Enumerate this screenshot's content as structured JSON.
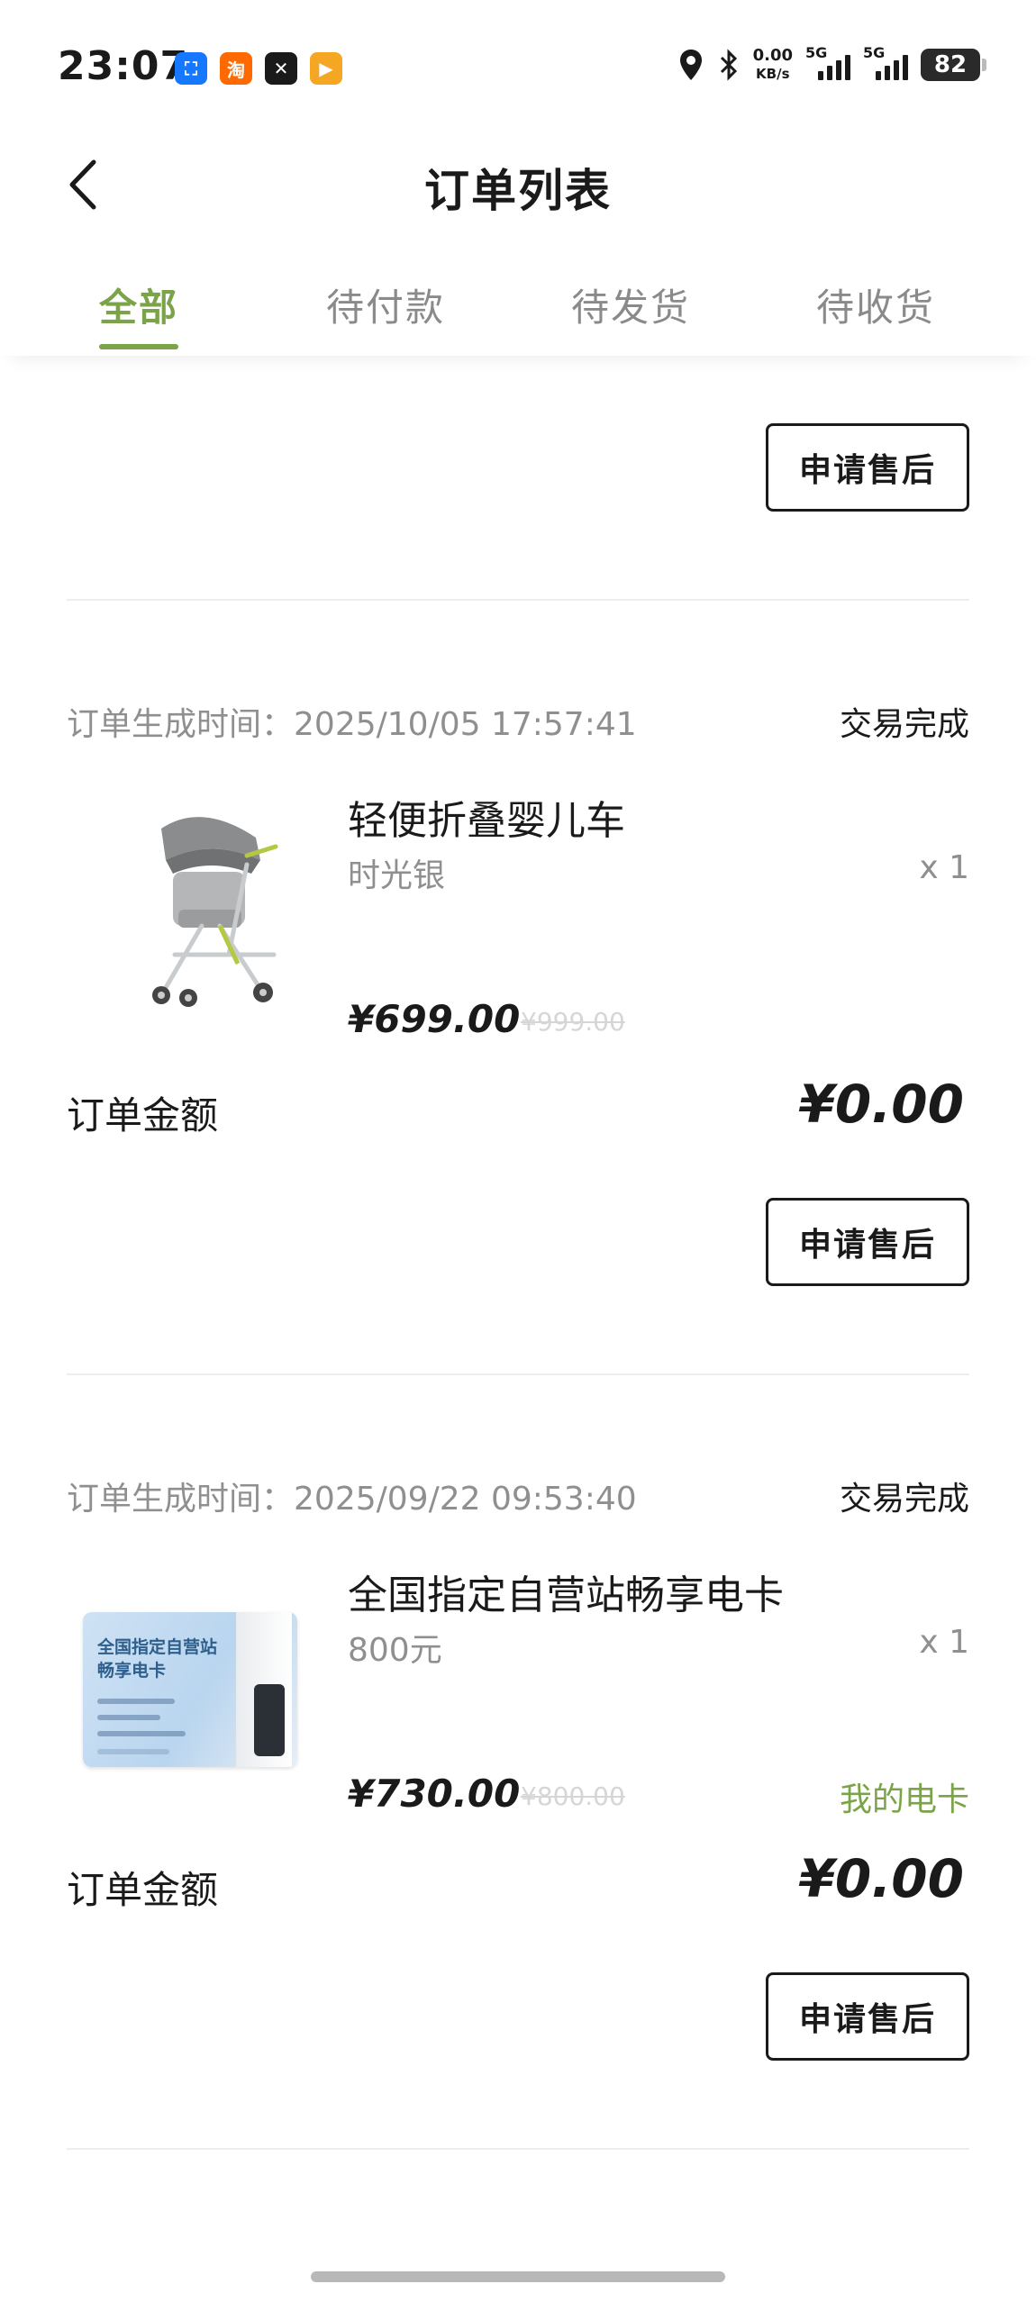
{
  "status_bar": {
    "time": "23:07",
    "apps": [
      {
        "icon": "app-blue-icon",
        "color": "#1677ff",
        "glyph": "⛶"
      },
      {
        "icon": "taobao-icon",
        "color": "#ff6a00",
        "glyph": "淘"
      },
      {
        "icon": "x-app-icon",
        "color": "#1a1a1a",
        "glyph": "✕"
      },
      {
        "icon": "video-app-icon",
        "color": "#f5a623",
        "glyph": "▶"
      }
    ],
    "net_speed": "0.00",
    "net_unit": "KB/s",
    "signal_1": "5G",
    "signal_2": "5G",
    "battery": "82"
  },
  "header": {
    "title": "订单列表"
  },
  "tabs": [
    {
      "label": "全部",
      "active": true
    },
    {
      "label": "待付款",
      "active": false
    },
    {
      "label": "待发货",
      "active": false
    },
    {
      "label": "待收货",
      "active": false
    }
  ],
  "orders": [
    {
      "after_sale_label": "申请售后"
    },
    {
      "created_label": "订单生成时间：",
      "created_time": "2025/10/05 17:57:41",
      "status": "交易完成",
      "product_name": "轻便折叠婴儿车",
      "spec": "时光银",
      "qty": "x 1",
      "price": "¥699.00",
      "original_price": "¥999.00",
      "total_label": "订单金额",
      "total": "¥0.00",
      "after_sale_label": "申请售后"
    },
    {
      "created_label": "订单生成时间：",
      "created_time": "2025/09/22 09:53:40",
      "status": "交易完成",
      "product_name": "全国指定自营站畅享电卡",
      "spec": "800元",
      "qty": "x 1",
      "price": "¥730.00",
      "original_price": "¥800.00",
      "extra_link": "我的电卡",
      "card_title_1": "全国指定自营站",
      "card_title_2": "畅享电卡",
      "total_label": "订单金额",
      "total": "¥0.00",
      "after_sale_label": "申请售后"
    }
  ],
  "colors": {
    "accent_green": "#7aa34a",
    "muted_text": "#8f8f8f"
  }
}
